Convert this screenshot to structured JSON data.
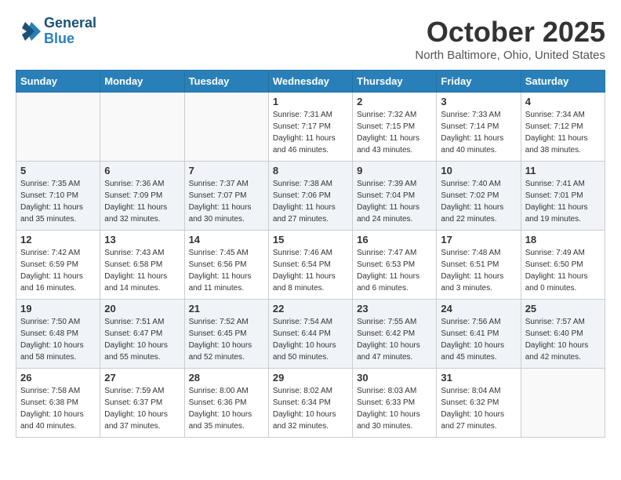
{
  "header": {
    "logo_line1": "General",
    "logo_line2": "Blue",
    "month": "October 2025",
    "location": "North Baltimore, Ohio, United States"
  },
  "days_of_week": [
    "Sunday",
    "Monday",
    "Tuesday",
    "Wednesday",
    "Thursday",
    "Friday",
    "Saturday"
  ],
  "weeks": [
    [
      {
        "day": "",
        "info": ""
      },
      {
        "day": "",
        "info": ""
      },
      {
        "day": "",
        "info": ""
      },
      {
        "day": "1",
        "info": "Sunrise: 7:31 AM\nSunset: 7:17 PM\nDaylight: 11 hours\nand 46 minutes."
      },
      {
        "day": "2",
        "info": "Sunrise: 7:32 AM\nSunset: 7:15 PM\nDaylight: 11 hours\nand 43 minutes."
      },
      {
        "day": "3",
        "info": "Sunrise: 7:33 AM\nSunset: 7:14 PM\nDaylight: 11 hours\nand 40 minutes."
      },
      {
        "day": "4",
        "info": "Sunrise: 7:34 AM\nSunset: 7:12 PM\nDaylight: 11 hours\nand 38 minutes."
      }
    ],
    [
      {
        "day": "5",
        "info": "Sunrise: 7:35 AM\nSunset: 7:10 PM\nDaylight: 11 hours\nand 35 minutes."
      },
      {
        "day": "6",
        "info": "Sunrise: 7:36 AM\nSunset: 7:09 PM\nDaylight: 11 hours\nand 32 minutes."
      },
      {
        "day": "7",
        "info": "Sunrise: 7:37 AM\nSunset: 7:07 PM\nDaylight: 11 hours\nand 30 minutes."
      },
      {
        "day": "8",
        "info": "Sunrise: 7:38 AM\nSunset: 7:06 PM\nDaylight: 11 hours\nand 27 minutes."
      },
      {
        "day": "9",
        "info": "Sunrise: 7:39 AM\nSunset: 7:04 PM\nDaylight: 11 hours\nand 24 minutes."
      },
      {
        "day": "10",
        "info": "Sunrise: 7:40 AM\nSunset: 7:02 PM\nDaylight: 11 hours\nand 22 minutes."
      },
      {
        "day": "11",
        "info": "Sunrise: 7:41 AM\nSunset: 7:01 PM\nDaylight: 11 hours\nand 19 minutes."
      }
    ],
    [
      {
        "day": "12",
        "info": "Sunrise: 7:42 AM\nSunset: 6:59 PM\nDaylight: 11 hours\nand 16 minutes."
      },
      {
        "day": "13",
        "info": "Sunrise: 7:43 AM\nSunset: 6:58 PM\nDaylight: 11 hours\nand 14 minutes."
      },
      {
        "day": "14",
        "info": "Sunrise: 7:45 AM\nSunset: 6:56 PM\nDaylight: 11 hours\nand 11 minutes."
      },
      {
        "day": "15",
        "info": "Sunrise: 7:46 AM\nSunset: 6:54 PM\nDaylight: 11 hours\nand 8 minutes."
      },
      {
        "day": "16",
        "info": "Sunrise: 7:47 AM\nSunset: 6:53 PM\nDaylight: 11 hours\nand 6 minutes."
      },
      {
        "day": "17",
        "info": "Sunrise: 7:48 AM\nSunset: 6:51 PM\nDaylight: 11 hours\nand 3 minutes."
      },
      {
        "day": "18",
        "info": "Sunrise: 7:49 AM\nSunset: 6:50 PM\nDaylight: 11 hours\nand 0 minutes."
      }
    ],
    [
      {
        "day": "19",
        "info": "Sunrise: 7:50 AM\nSunset: 6:48 PM\nDaylight: 10 hours\nand 58 minutes."
      },
      {
        "day": "20",
        "info": "Sunrise: 7:51 AM\nSunset: 6:47 PM\nDaylight: 10 hours\nand 55 minutes."
      },
      {
        "day": "21",
        "info": "Sunrise: 7:52 AM\nSunset: 6:45 PM\nDaylight: 10 hours\nand 52 minutes."
      },
      {
        "day": "22",
        "info": "Sunrise: 7:54 AM\nSunset: 6:44 PM\nDaylight: 10 hours\nand 50 minutes."
      },
      {
        "day": "23",
        "info": "Sunrise: 7:55 AM\nSunset: 6:42 PM\nDaylight: 10 hours\nand 47 minutes."
      },
      {
        "day": "24",
        "info": "Sunrise: 7:56 AM\nSunset: 6:41 PM\nDaylight: 10 hours\nand 45 minutes."
      },
      {
        "day": "25",
        "info": "Sunrise: 7:57 AM\nSunset: 6:40 PM\nDaylight: 10 hours\nand 42 minutes."
      }
    ],
    [
      {
        "day": "26",
        "info": "Sunrise: 7:58 AM\nSunset: 6:38 PM\nDaylight: 10 hours\nand 40 minutes."
      },
      {
        "day": "27",
        "info": "Sunrise: 7:59 AM\nSunset: 6:37 PM\nDaylight: 10 hours\nand 37 minutes."
      },
      {
        "day": "28",
        "info": "Sunrise: 8:00 AM\nSunset: 6:36 PM\nDaylight: 10 hours\nand 35 minutes."
      },
      {
        "day": "29",
        "info": "Sunrise: 8:02 AM\nSunset: 6:34 PM\nDaylight: 10 hours\nand 32 minutes."
      },
      {
        "day": "30",
        "info": "Sunrise: 8:03 AM\nSunset: 6:33 PM\nDaylight: 10 hours\nand 30 minutes."
      },
      {
        "day": "31",
        "info": "Sunrise: 8:04 AM\nSunset: 6:32 PM\nDaylight: 10 hours\nand 27 minutes."
      },
      {
        "day": "",
        "info": ""
      }
    ]
  ]
}
